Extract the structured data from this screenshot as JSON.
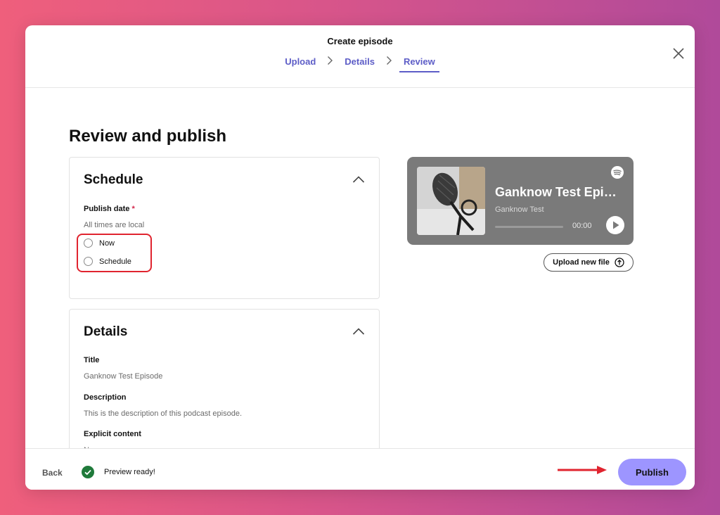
{
  "header": {
    "title": "Create episode",
    "steps": [
      {
        "label": "Upload"
      },
      {
        "label": "Details"
      },
      {
        "label": "Review"
      }
    ]
  },
  "main": {
    "page_title": "Review and publish",
    "schedule": {
      "title": "Schedule",
      "publish_date_label": "Publish date",
      "required_mark": "*",
      "timezone_note": "All times are local",
      "options": [
        {
          "label": "Now"
        },
        {
          "label": "Schedule"
        }
      ]
    },
    "details": {
      "title": "Details",
      "title_label": "Title",
      "title_value": "Ganknow Test Episode",
      "description_label": "Description",
      "description_value": "This is the description of this podcast episode.",
      "explicit_label": "Explicit content",
      "explicit_value": "No"
    },
    "preview": {
      "episode_title": "Ganknow Test Epi…",
      "show_name": "Ganknow Test",
      "time": "00:00",
      "upload_label": "Upload new file"
    }
  },
  "footer": {
    "back_label": "Back",
    "status": "Preview ready!",
    "publish_label": "Publish"
  },
  "colors": {
    "accent": "#5d5dc7",
    "publish_button": "#9d95ff",
    "player_bg": "#7a7a7a",
    "success": "#1f7a3a",
    "annotation": "#e0242f"
  },
  "icons": [
    "close-icon",
    "chevron-right-icon",
    "chevron-up-icon",
    "spotify-icon",
    "play-icon",
    "upload-icon",
    "check-circle-icon",
    "arrow-right-icon"
  ]
}
